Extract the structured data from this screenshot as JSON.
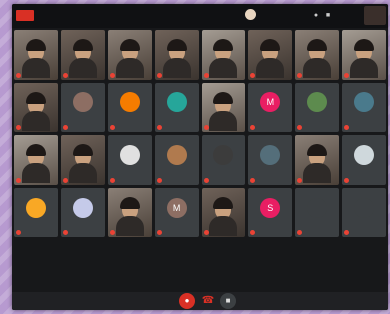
{
  "topbar": {
    "live_label": "",
    "host_name": "",
    "participant_count": ""
  },
  "participants": [
    {
      "name": "",
      "kind": "video",
      "variant": "v2"
    },
    {
      "name": "",
      "kind": "video",
      "variant": ""
    },
    {
      "name": "",
      "kind": "video",
      "variant": "v2"
    },
    {
      "name": "",
      "kind": "video",
      "variant": ""
    },
    {
      "name": "",
      "kind": "video",
      "variant": "v3"
    },
    {
      "name": "",
      "kind": "video",
      "variant": ""
    },
    {
      "name": "",
      "kind": "video",
      "variant": "v2"
    },
    {
      "name": "",
      "kind": "video",
      "variant": "v3"
    },
    {
      "name": "",
      "kind": "video",
      "variant": ""
    },
    {
      "name": "",
      "kind": "avatar",
      "letter": "",
      "color": "#8d6e63"
    },
    {
      "name": "",
      "kind": "avatar",
      "letter": "",
      "color": "#f57c00"
    },
    {
      "name": "",
      "kind": "avatar",
      "letter": "",
      "color": "#26a69a"
    },
    {
      "name": "",
      "kind": "video",
      "variant": "v3"
    },
    {
      "name": "",
      "kind": "avatar",
      "letter": "M",
      "color": "#e91e63"
    },
    {
      "name": "",
      "kind": "avatar",
      "letter": "",
      "color": "#5d8b4e"
    },
    {
      "name": "",
      "kind": "avatar",
      "letter": "",
      "color": "#4a7a8c"
    },
    {
      "name": "",
      "kind": "video",
      "variant": "v3"
    },
    {
      "name": "",
      "kind": "video",
      "variant": ""
    },
    {
      "name": "",
      "kind": "avatar",
      "letter": "",
      "color": "#e0e0e0"
    },
    {
      "name": "",
      "kind": "avatar",
      "letter": "",
      "color": "#b07a4e"
    },
    {
      "name": "",
      "kind": "avatar",
      "letter": "",
      "color": "#3c3c3c"
    },
    {
      "name": "",
      "kind": "avatar",
      "letter": "",
      "color": "#546e7a"
    },
    {
      "name": "",
      "kind": "video",
      "variant": "v2"
    },
    {
      "name": "",
      "kind": "avatar",
      "letter": "",
      "color": "#cfd8dc"
    },
    {
      "name": "",
      "kind": "avatar",
      "letter": "",
      "color": "#f9a825"
    },
    {
      "name": "",
      "kind": "avatar",
      "letter": "",
      "color": "#c5cae9"
    },
    {
      "name": "",
      "kind": "video",
      "variant": "v2"
    },
    {
      "name": "",
      "kind": "avatar",
      "letter": "M",
      "color": "#8d6e63"
    },
    {
      "name": "",
      "kind": "video",
      "variant": ""
    },
    {
      "name": "",
      "kind": "avatar",
      "letter": "S",
      "color": "#e91e63"
    },
    {
      "name": "",
      "kind": "avatar",
      "letter": "",
      "color": "#3c4043"
    },
    {
      "name": "",
      "kind": "avatar",
      "letter": "",
      "color": "#3c4043"
    }
  ],
  "bottombar": {
    "meeting_info": "",
    "captions_label": "",
    "present_label": ""
  },
  "colors": {
    "accent_red": "#d93025",
    "tile_bg": "#3c4043"
  }
}
